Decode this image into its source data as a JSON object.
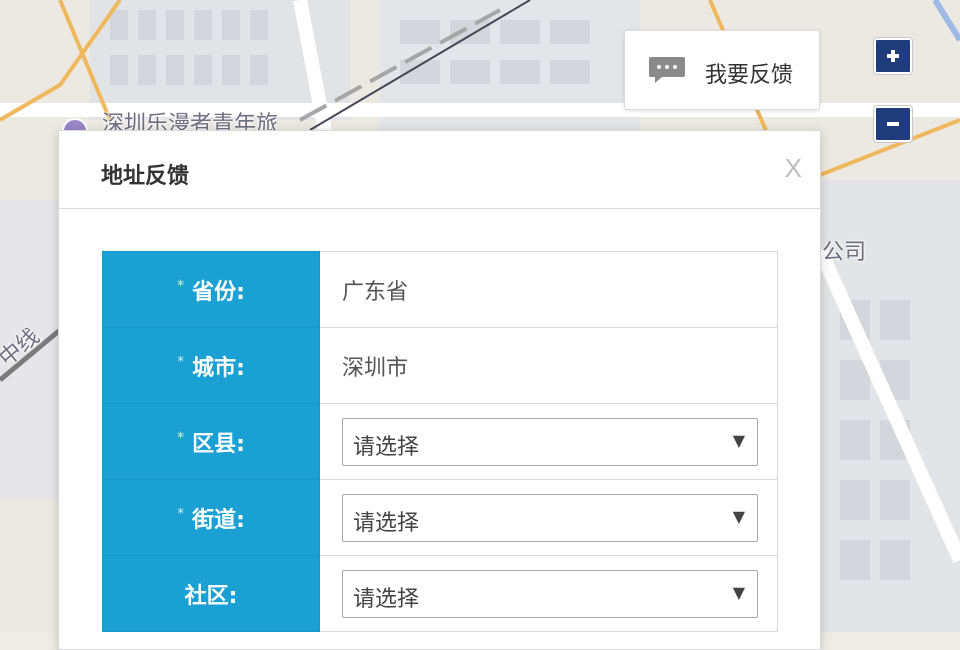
{
  "map": {
    "labels": [
      "深圳乐漫者青年旅",
      "公司",
      "中线"
    ]
  },
  "feedback_button": {
    "label": "我要反馈"
  },
  "zoom": {
    "in_label": "+",
    "out_label": "−"
  },
  "dialog": {
    "title": "地址反馈",
    "close_label": "X",
    "required_mark": "*",
    "rows": [
      {
        "label": "省份:",
        "value": "广东省",
        "type": "text",
        "required": true
      },
      {
        "label": "城市:",
        "value": "深圳市",
        "type": "text",
        "required": true
      },
      {
        "label": "区县:",
        "value": "请选择",
        "type": "select",
        "required": true
      },
      {
        "label": "街道:",
        "value": "请选择",
        "type": "select",
        "required": true
      },
      {
        "label": "社区:",
        "value": "请选择",
        "type": "select",
        "required": false
      }
    ]
  },
  "colors": {
    "label_bg": "#1aa0d3",
    "zoom_bg": "#1e3d7a",
    "road_major": "#f0b85c"
  },
  "icons": {
    "feedback": "chat-bubble-icon",
    "zoom_in": "plus-icon",
    "zoom_out": "minus-icon",
    "dropdown": "caret-down-icon"
  }
}
